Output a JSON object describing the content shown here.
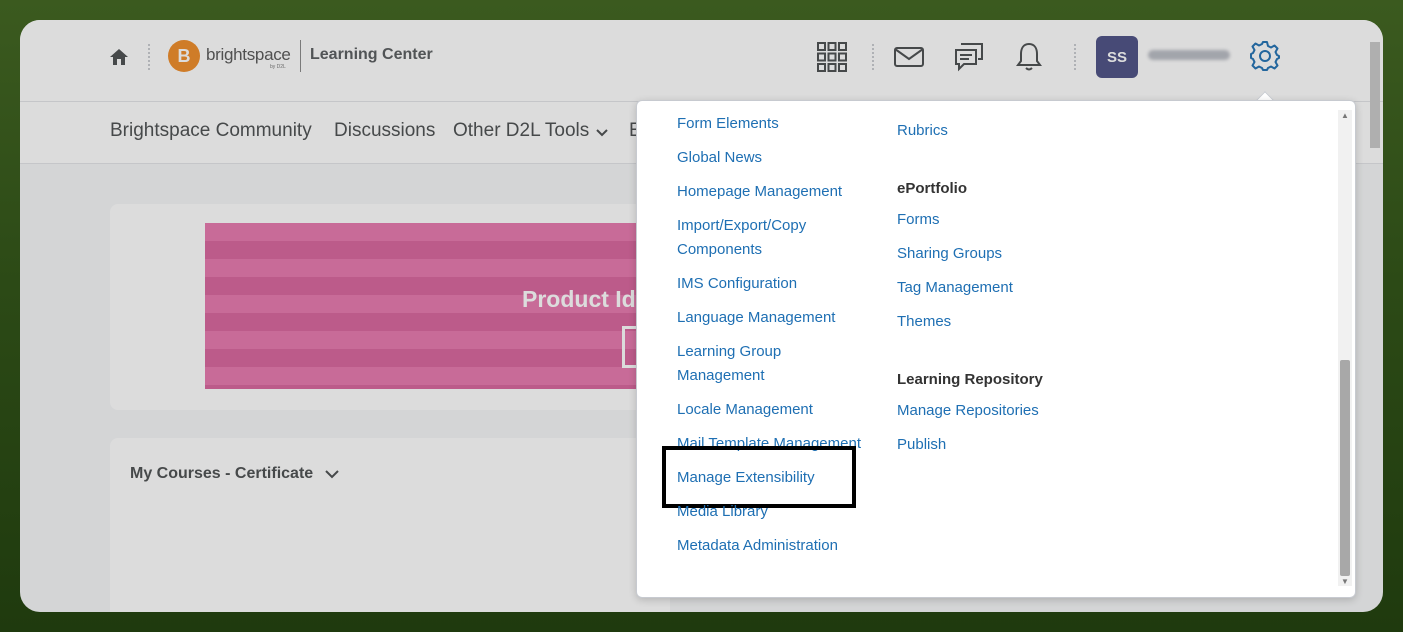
{
  "header": {
    "org_name": "Learning Center",
    "logo": {
      "word": "brightspace",
      "byline": "by D2L",
      "letter": "B"
    },
    "avatar_initials": "SS"
  },
  "subnav": {
    "items": [
      "Brightspace Community",
      "Discussions",
      "Other D2L Tools",
      "E"
    ]
  },
  "main": {
    "banner_title": "Product Id",
    "courses_title": "My Courses - Certificate"
  },
  "dropdown": {
    "col1": [
      "Form Elements",
      "Global News",
      "Homepage Management",
      "Import/Export/Copy",
      "Components",
      "IMS Configuration",
      "Language Management",
      "Learning Group",
      "Management",
      "Locale Management",
      "Mail Template Management",
      "Manage Extensibility",
      "Media Library",
      "Metadata Administration"
    ],
    "col2_top_link": "Rubrics",
    "eportfolio_heading": "ePortfolio",
    "eportfolio_links": [
      "Forms",
      "Sharing Groups",
      "Tag Management",
      "Themes"
    ],
    "repository_heading": "Learning Repository",
    "repository_links": [
      "Manage Repositories",
      "Publish"
    ]
  },
  "colors": {
    "link": "#1e6fb3",
    "avatar": "#4a4e83",
    "logo": "#f08a24",
    "settings_icon": "#1e6fb3"
  },
  "icons": [
    "home-icon",
    "waffle-grid-icon",
    "mail-icon",
    "chat-icon",
    "bell-icon",
    "gear-icon",
    "chevron-down-icon"
  ]
}
